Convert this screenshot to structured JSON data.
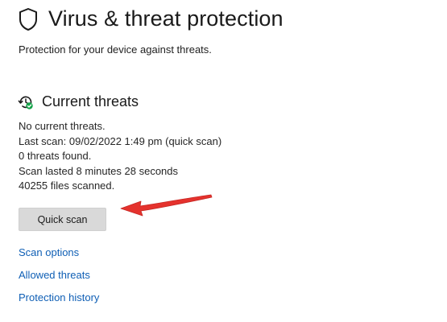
{
  "header": {
    "title": "Virus & threat protection",
    "subtitle": "Protection for your device against threats.",
    "icon": "shield-icon"
  },
  "current_threats": {
    "title": "Current threats",
    "icon": "threat-history-icon",
    "status": "No current threats.",
    "last_scan": "Last scan: 09/02/2022 1:49 pm (quick scan)",
    "threats_found": "0 threats found.",
    "duration": "Scan lasted 8 minutes 28 seconds",
    "files_scanned": "40255 files scanned."
  },
  "actions": {
    "quick_scan_label": "Quick scan"
  },
  "links": [
    {
      "label": "Scan options"
    },
    {
      "label": "Allowed threats"
    },
    {
      "label": "Protection history"
    }
  ],
  "colors": {
    "link": "#0f5fb5",
    "button_bg": "#d9d9d9",
    "annotation_arrow": "#e5322d",
    "status_ok": "#16a34a"
  }
}
